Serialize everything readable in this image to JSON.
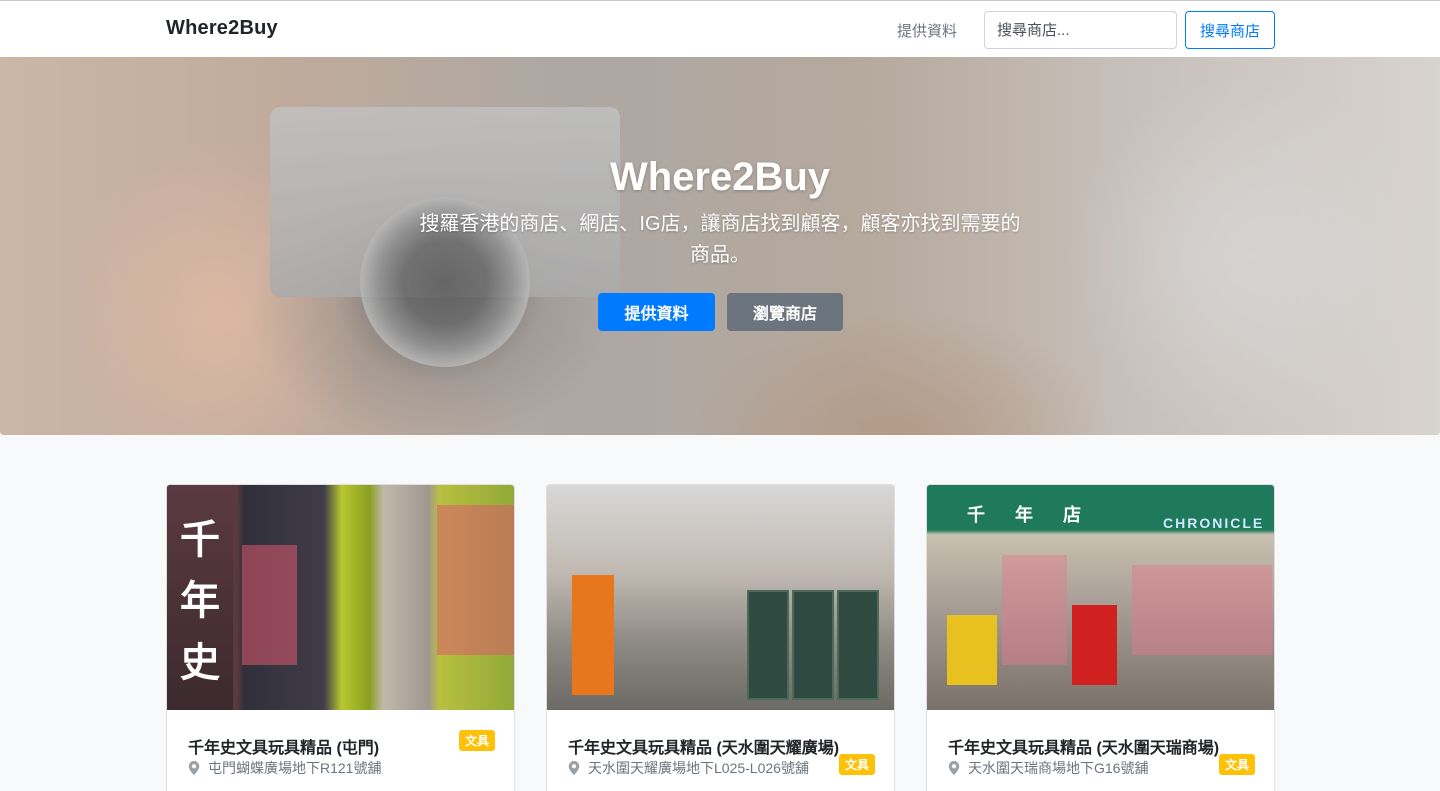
{
  "navbar": {
    "brand": "Where2Buy",
    "link_submit": "提供資料",
    "search_placeholder": "搜尋商店...",
    "search_button": "搜尋商店"
  },
  "hero": {
    "title": "Where2Buy",
    "subtitle": "搜羅香港的商店、網店、IG店，讓商店找到顧客，顧客亦找到需要的商品。",
    "primary_button": "提供資料",
    "secondary_button": "瀏覽商店"
  },
  "cards": [
    {
      "title": "千年史文具玩具精品 (屯門)",
      "address": "屯門蝴蝶廣場地下R121號舖",
      "badge": "文具",
      "image_sign": [
        "千",
        "年",
        "史"
      ]
    },
    {
      "title": "千年史文具玩具精品 (天水圍天耀廣場)",
      "address": "天水圍天耀廣場地下L025-L026號舖",
      "badge": "文具"
    },
    {
      "title": "千年史文具玩具精品 (天水圍天瑞商場)",
      "address": "天水圍天瑞商場地下G16號舖",
      "badge": "文具",
      "image_sign": "千年店",
      "image_sign2": "CHRONICLE"
    }
  ],
  "colors": {
    "primary": "#007bff",
    "secondary": "#6c757d",
    "badge": "#ffc107"
  }
}
